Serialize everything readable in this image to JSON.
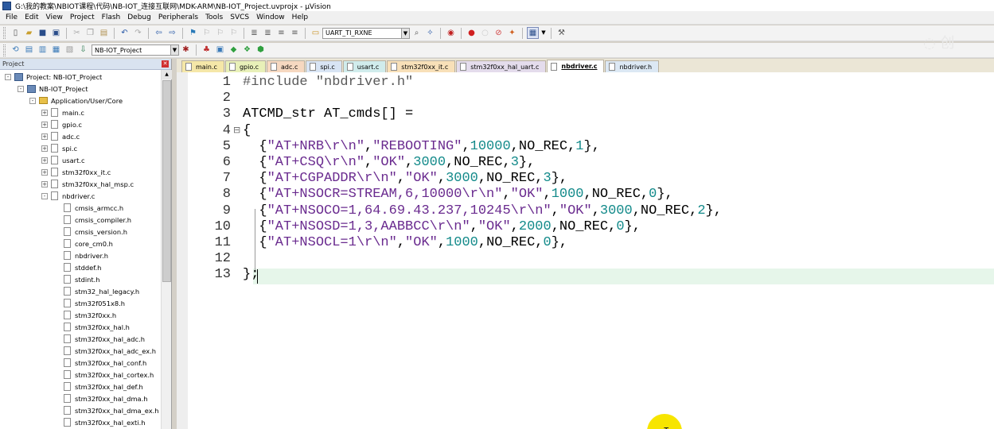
{
  "window": {
    "title": "G:\\我的教案\\NBIOT课程\\代码\\NB-IOT_连接互联网\\MDK-ARM\\NB-IOT_Project.uvprojx - µVision"
  },
  "menu": [
    "File",
    "Edit",
    "View",
    "Project",
    "Flash",
    "Debug",
    "Peripherals",
    "Tools",
    "SVCS",
    "Window",
    "Help"
  ],
  "toolbar": {
    "search_combo": "UART_TI_RXNE",
    "target_combo": "NB-IOT_Project"
  },
  "project_panel": {
    "title": "Project",
    "close_label": "✕",
    "tree": [
      {
        "label": "Project: NB-IOT_Project",
        "level": 0,
        "kind": "project",
        "expander": "-"
      },
      {
        "label": "NB-IOT_Project",
        "level": 1,
        "kind": "target",
        "expander": "-"
      },
      {
        "label": "Application/User/Core",
        "level": 2,
        "kind": "folder",
        "expander": "-"
      },
      {
        "label": "main.c",
        "level": 3,
        "kind": "file",
        "expander": "+"
      },
      {
        "label": "gpio.c",
        "level": 3,
        "kind": "file",
        "expander": "+"
      },
      {
        "label": "adc.c",
        "level": 3,
        "kind": "file",
        "expander": "+"
      },
      {
        "label": "spi.c",
        "level": 3,
        "kind": "file",
        "expander": "+"
      },
      {
        "label": "usart.c",
        "level": 3,
        "kind": "file",
        "expander": "+"
      },
      {
        "label": "stm32f0xx_it.c",
        "level": 3,
        "kind": "file",
        "expander": "+"
      },
      {
        "label": "stm32f0xx_hal_msp.c",
        "level": 3,
        "kind": "file",
        "expander": "+"
      },
      {
        "label": "nbdriver.c",
        "level": 3,
        "kind": "file",
        "expander": "-"
      },
      {
        "label": "cmsis_armcc.h",
        "level": 4,
        "kind": "file",
        "expander": ""
      },
      {
        "label": "cmsis_compiler.h",
        "level": 4,
        "kind": "file",
        "expander": ""
      },
      {
        "label": "cmsis_version.h",
        "level": 4,
        "kind": "file",
        "expander": ""
      },
      {
        "label": "core_cm0.h",
        "level": 4,
        "kind": "file",
        "expander": ""
      },
      {
        "label": "nbdriver.h",
        "level": 4,
        "kind": "file",
        "expander": ""
      },
      {
        "label": "stddef.h",
        "level": 4,
        "kind": "file",
        "expander": ""
      },
      {
        "label": "stdint.h",
        "level": 4,
        "kind": "file",
        "expander": ""
      },
      {
        "label": "stm32_hal_legacy.h",
        "level": 4,
        "kind": "file",
        "expander": ""
      },
      {
        "label": "stm32f051x8.h",
        "level": 4,
        "kind": "file",
        "expander": ""
      },
      {
        "label": "stm32f0xx.h",
        "level": 4,
        "kind": "file",
        "expander": ""
      },
      {
        "label": "stm32f0xx_hal.h",
        "level": 4,
        "kind": "file",
        "expander": ""
      },
      {
        "label": "stm32f0xx_hal_adc.h",
        "level": 4,
        "kind": "file",
        "expander": ""
      },
      {
        "label": "stm32f0xx_hal_adc_ex.h",
        "level": 4,
        "kind": "file",
        "expander": ""
      },
      {
        "label": "stm32f0xx_hal_conf.h",
        "level": 4,
        "kind": "file",
        "expander": ""
      },
      {
        "label": "stm32f0xx_hal_cortex.h",
        "level": 4,
        "kind": "file",
        "expander": ""
      },
      {
        "label": "stm32f0xx_hal_def.h",
        "level": 4,
        "kind": "file",
        "expander": ""
      },
      {
        "label": "stm32f0xx_hal_dma.h",
        "level": 4,
        "kind": "file",
        "expander": ""
      },
      {
        "label": "stm32f0xx_hal_dma_ex.h",
        "level": 4,
        "kind": "file",
        "expander": ""
      },
      {
        "label": "stm32f0xx_hal_exti.h",
        "level": 4,
        "kind": "file",
        "expander": ""
      }
    ]
  },
  "tabs": [
    {
      "label": "main.c",
      "color": "#f5e7a8"
    },
    {
      "label": "gpio.c",
      "color": "#e8f0b8"
    },
    {
      "label": "adc.c",
      "color": "#f6d8c0"
    },
    {
      "label": "spi.c",
      "color": "#d8e4f4"
    },
    {
      "label": "usart.c",
      "color": "#d0ecec"
    },
    {
      "label": "stm32f0xx_it.c",
      "color": "#f8e0b8"
    },
    {
      "label": "stm32f0xx_hal_uart.c",
      "color": "#e4dcec"
    },
    {
      "label": "nbdriver.c",
      "color": "#ffffff",
      "active": true
    },
    {
      "label": "nbdriver.h",
      "color": "#dce8f4"
    }
  ],
  "editor": {
    "lines": [
      {
        "n": "1",
        "fold": "",
        "parts": [
          [
            "pp",
            "#include \"nbdriver.h\""
          ]
        ]
      },
      {
        "n": "2",
        "fold": "",
        "parts": []
      },
      {
        "n": "3",
        "fold": "",
        "parts": [
          [
            "id",
            "ATCMD_str AT_cmds[] ="
          ]
        ]
      },
      {
        "n": "4",
        "fold": "⊟",
        "parts": [
          [
            "id",
            "{"
          ]
        ]
      },
      {
        "n": "5",
        "fold": "",
        "parts": [
          [
            "id",
            "  {"
          ],
          [
            "str",
            "\"AT+NRB\\r\\n\""
          ],
          [
            "id",
            ","
          ],
          [
            "str",
            "\"REBOOTING\""
          ],
          [
            "id",
            ","
          ],
          [
            "num",
            "10000"
          ],
          [
            "id",
            ",NO_REC,"
          ],
          [
            "num",
            "1"
          ],
          [
            "id",
            "},"
          ]
        ]
      },
      {
        "n": "6",
        "fold": "",
        "parts": [
          [
            "id",
            "  {"
          ],
          [
            "str",
            "\"AT+CSQ\\r\\n\""
          ],
          [
            "id",
            ","
          ],
          [
            "str",
            "\"OK\""
          ],
          [
            "id",
            ","
          ],
          [
            "num",
            "3000"
          ],
          [
            "id",
            ",NO_REC,"
          ],
          [
            "num",
            "3"
          ],
          [
            "id",
            "},"
          ]
        ]
      },
      {
        "n": "7",
        "fold": "",
        "parts": [
          [
            "id",
            "  {"
          ],
          [
            "str",
            "\"AT+CGPADDR\\r\\n\""
          ],
          [
            "id",
            ","
          ],
          [
            "str",
            "\"OK\""
          ],
          [
            "id",
            ","
          ],
          [
            "num",
            "3000"
          ],
          [
            "id",
            ",NO_REC,"
          ],
          [
            "num",
            "3"
          ],
          [
            "id",
            "},"
          ]
        ]
      },
      {
        "n": "8",
        "fold": "",
        "parts": [
          [
            "id",
            "  {"
          ],
          [
            "str",
            "\"AT+NSOCR=STREAM,6,10000\\r\\n\""
          ],
          [
            "id",
            ","
          ],
          [
            "str",
            "\"OK\""
          ],
          [
            "id",
            ","
          ],
          [
            "num",
            "1000"
          ],
          [
            "id",
            ",NO_REC,"
          ],
          [
            "num",
            "0"
          ],
          [
            "id",
            "},"
          ]
        ]
      },
      {
        "n": "9",
        "fold": "",
        "parts": [
          [
            "id",
            "  {"
          ],
          [
            "str",
            "\"AT+NSOCO=1,64.69.43.237,10245\\r\\n\""
          ],
          [
            "id",
            ","
          ],
          [
            "str",
            "\"OK\""
          ],
          [
            "id",
            ","
          ],
          [
            "num",
            "3000"
          ],
          [
            "id",
            ",NO_REC,"
          ],
          [
            "num",
            "2"
          ],
          [
            "id",
            "},"
          ]
        ]
      },
      {
        "n": "10",
        "fold": "",
        "parts": [
          [
            "id",
            "  {"
          ],
          [
            "str",
            "\"AT+NSOSD=1,3,AABBCC\\r\\n\""
          ],
          [
            "id",
            ","
          ],
          [
            "str",
            "\"OK\""
          ],
          [
            "id",
            ","
          ],
          [
            "num",
            "2000"
          ],
          [
            "id",
            ",NO_REC,"
          ],
          [
            "num",
            "0"
          ],
          [
            "id",
            "},"
          ]
        ]
      },
      {
        "n": "11",
        "fold": "",
        "parts": [
          [
            "id",
            "  {"
          ],
          [
            "str",
            "\"AT+NSOCL=1\\r\\n\""
          ],
          [
            "id",
            ","
          ],
          [
            "str",
            "\"OK\""
          ],
          [
            "id",
            ","
          ],
          [
            "num",
            "1000"
          ],
          [
            "id",
            ",NO_REC,"
          ],
          [
            "num",
            "0"
          ],
          [
            "id",
            "},"
          ]
        ]
      },
      {
        "n": "12",
        "fold": "",
        "parts": []
      },
      {
        "n": "13",
        "fold": "",
        "parts": [
          [
            "id",
            "};"
          ]
        ]
      }
    ]
  },
  "cursor": {
    "glyph": "I"
  },
  "colors": {
    "string": "#6a2b8f",
    "number": "#138a8a",
    "preprocessor": "#5a5a5a",
    "current_line": "#e6f6ea",
    "highlight": "#f7e500"
  }
}
